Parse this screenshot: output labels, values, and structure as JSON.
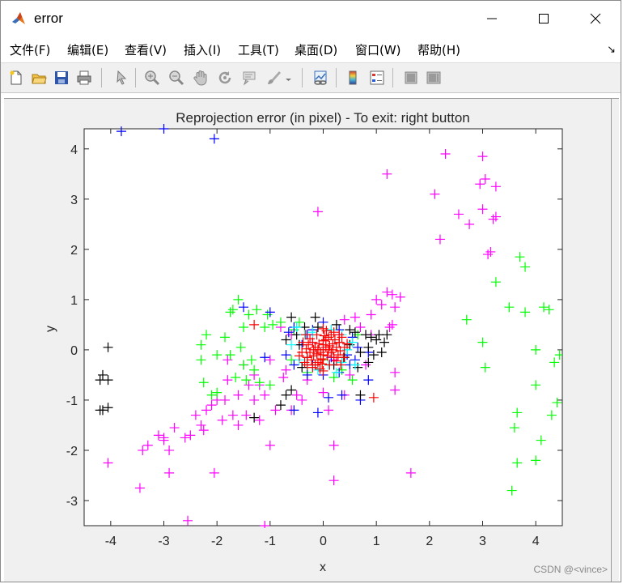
{
  "window": {
    "title": "error",
    "buttons": [
      "minimize",
      "maximize",
      "close"
    ]
  },
  "menubar": {
    "items": [
      {
        "label": "文件(F)"
      },
      {
        "label": "编辑(E)"
      },
      {
        "label": "查看(V)"
      },
      {
        "label": "插入(I)"
      },
      {
        "label": "工具(T)"
      },
      {
        "label": "桌面(D)"
      },
      {
        "label": "窗口(W)"
      },
      {
        "label": "帮助(H)"
      }
    ],
    "overflow_arrow": "↘"
  },
  "toolbar": {
    "icons": [
      "new-figure-icon",
      "open-file-icon",
      "save-icon",
      "print-icon",
      "pointer-icon",
      "zoom-in-icon",
      "zoom-out-icon",
      "pan-icon",
      "rotate-3d-icon",
      "data-cursor-icon",
      "brush-icon",
      "brush-dropdown-icon",
      "link-plot-icon",
      "colorbar-icon",
      "legend-icon",
      "hide-plot-tools-icon",
      "show-plot-tools-icon"
    ]
  },
  "watermark": "CSDN @<vince>",
  "chart_data": {
    "type": "scatter",
    "title": "Reprojection error (in pixel) - To exit: right button",
    "xlabel": "x",
    "ylabel": "y",
    "xlim": [
      -4.5,
      4.5
    ],
    "ylim": [
      -3.5,
      4.4
    ],
    "xticks": [
      -4,
      -3,
      -2,
      -1,
      0,
      1,
      2,
      3,
      4
    ],
    "yticks": [
      -3,
      -2,
      -1,
      0,
      1,
      2,
      3,
      4
    ],
    "marker": "+",
    "grid": false,
    "series": [
      {
        "color": "#ff00ff",
        "points": [
          [
            2.3,
            3.9
          ],
          [
            3.0,
            3.85
          ],
          [
            1.2,
            3.5
          ],
          [
            3.05,
            3.4
          ],
          [
            2.95,
            3.3
          ],
          [
            3.25,
            3.25
          ],
          [
            2.1,
            3.1
          ],
          [
            2.2,
            2.2
          ],
          [
            2.55,
            2.7
          ],
          [
            2.75,
            2.5
          ],
          [
            3.0,
            2.8
          ],
          [
            3.25,
            2.65
          ],
          [
            3.2,
            2.6
          ],
          [
            3.15,
            1.95
          ],
          [
            3.1,
            1.9
          ],
          [
            -0.1,
            2.75
          ],
          [
            1.2,
            1.15
          ],
          [
            1.3,
            1.1
          ],
          [
            1.45,
            1.05
          ],
          [
            1.0,
            1.0
          ],
          [
            1.1,
            0.9
          ],
          [
            1.35,
            0.85
          ],
          [
            0.9,
            0.7
          ],
          [
            0.6,
            0.65
          ],
          [
            1.3,
            0.5
          ],
          [
            1.25,
            0.45
          ],
          [
            0.4,
            0.6
          ],
          [
            0.7,
            0.45
          ],
          [
            -0.8,
            0.45
          ],
          [
            -0.6,
            0.3
          ],
          [
            -1.0,
            -0.2
          ],
          [
            -1.3,
            -0.5
          ],
          [
            -1.4,
            -0.7
          ],
          [
            -1.8,
            -0.6
          ],
          [
            -1.6,
            -0.9
          ],
          [
            -2.0,
            -1.0
          ],
          [
            -2.2,
            -1.2
          ],
          [
            -1.9,
            -1.4
          ],
          [
            -1.6,
            -1.5
          ],
          [
            -2.3,
            -1.5
          ],
          [
            -2.5,
            -1.7
          ],
          [
            -2.6,
            -1.75
          ],
          [
            -3.0,
            -1.8
          ],
          [
            -2.9,
            -2.0
          ],
          [
            -3.3,
            -1.9
          ],
          [
            -3.4,
            -2.0
          ],
          [
            -2.8,
            -1.55
          ],
          [
            -3.0,
            -1.75
          ],
          [
            -1.0,
            -1.9
          ],
          [
            -1.2,
            -1.4
          ],
          [
            -0.9,
            -1.2
          ],
          [
            -0.5,
            -0.9
          ],
          [
            -0.3,
            -0.6
          ],
          [
            -0.6,
            -1.2
          ],
          [
            0.1,
            -1.2
          ],
          [
            0.2,
            -1.9
          ],
          [
            0.2,
            -2.6
          ],
          [
            1.35,
            -0.45
          ],
          [
            1.35,
            -0.8
          ],
          [
            -4.05,
            -2.25
          ],
          [
            -3.45,
            -2.75
          ],
          [
            -2.9,
            -2.45
          ],
          [
            -2.05,
            -2.45
          ],
          [
            -2.55,
            -3.4
          ],
          [
            -1.1,
            -3.5
          ],
          [
            1.65,
            -2.45
          ],
          [
            -1.5,
            -0.3
          ],
          [
            -1.8,
            -0.2
          ],
          [
            -1.2,
            -0.7
          ],
          [
            -0.7,
            -0.4
          ],
          [
            0.5,
            -0.5
          ],
          [
            0.8,
            -0.3
          ],
          [
            0.3,
            0.3
          ],
          [
            -0.2,
            0.15
          ],
          [
            0.2,
            -0.2
          ],
          [
            -2.1,
            -1.1
          ],
          [
            -1.7,
            -1.3
          ],
          [
            -2.4,
            -1.3
          ],
          [
            -3.1,
            -1.7
          ],
          [
            -1.1,
            -0.9
          ],
          [
            -0.4,
            -1.0
          ],
          [
            0.0,
            -0.85
          ],
          [
            0.4,
            -0.9
          ],
          [
            -1.3,
            -1.0
          ],
          [
            -1.45,
            -1.3
          ],
          [
            -2.25,
            -1.6
          ],
          [
            -1.85,
            -1.0
          ],
          [
            -0.75,
            -0.55
          ],
          [
            0.9,
            0.3
          ]
        ]
      },
      {
        "color": "#00ff00",
        "points": [
          [
            3.7,
            1.85
          ],
          [
            3.8,
            1.65
          ],
          [
            3.25,
            1.35
          ],
          [
            3.5,
            0.85
          ],
          [
            3.8,
            0.75
          ],
          [
            4.15,
            0.85
          ],
          [
            4.25,
            0.8
          ],
          [
            2.7,
            0.6
          ],
          [
            3.0,
            0.15
          ],
          [
            4.0,
            0.0
          ],
          [
            4.45,
            -0.1
          ],
          [
            4.35,
            -0.25
          ],
          [
            3.05,
            -0.35
          ],
          [
            4.0,
            -0.7
          ],
          [
            4.4,
            -1.05
          ],
          [
            3.65,
            -1.25
          ],
          [
            4.3,
            -1.3
          ],
          [
            3.6,
            -1.55
          ],
          [
            4.1,
            -1.8
          ],
          [
            3.65,
            -2.25
          ],
          [
            4.0,
            -2.2
          ],
          [
            3.55,
            -2.8
          ],
          [
            -1.6,
            1.0
          ],
          [
            -1.7,
            0.8
          ],
          [
            -1.25,
            0.8
          ],
          [
            -1.4,
            0.7
          ],
          [
            -1.05,
            0.7
          ],
          [
            -0.95,
            0.5
          ],
          [
            -0.8,
            0.55
          ],
          [
            -1.5,
            0.45
          ],
          [
            -1.1,
            0.45
          ],
          [
            -0.55,
            0.4
          ],
          [
            -2.2,
            0.3
          ],
          [
            -1.85,
            0.25
          ],
          [
            -2.3,
            0.1
          ],
          [
            -2.3,
            -0.2
          ],
          [
            -1.55,
            0.05
          ],
          [
            -1.75,
            -0.1
          ],
          [
            -2.0,
            -0.1
          ],
          [
            -1.5,
            -0.3
          ],
          [
            -1.3,
            -0.4
          ],
          [
            -1.65,
            -0.55
          ],
          [
            -2.0,
            -0.85
          ],
          [
            -2.1,
            -0.9
          ],
          [
            -2.25,
            -0.65
          ],
          [
            -1.45,
            -0.6
          ],
          [
            -1.0,
            -0.7
          ],
          [
            -1.2,
            -0.65
          ],
          [
            -0.6,
            -0.2
          ],
          [
            -0.3,
            -0.45
          ],
          [
            0.2,
            -0.55
          ],
          [
            0.35,
            -0.4
          ],
          [
            0.55,
            -0.6
          ],
          [
            -0.2,
            -0.3
          ],
          [
            0.0,
            -0.2
          ],
          [
            -1.75,
            0.75
          ],
          [
            -1.35,
            -0.2
          ],
          [
            0.65,
            0.3
          ],
          [
            -0.45,
            0.55
          ]
        ]
      },
      {
        "color": "#0000ff",
        "points": [
          [
            -3.8,
            4.35
          ],
          [
            -3.0,
            4.4
          ],
          [
            -2.05,
            4.2
          ],
          [
            -1.5,
            0.85
          ],
          [
            -1.0,
            0.75
          ],
          [
            -0.55,
            0.45
          ],
          [
            -0.3,
            0.3
          ],
          [
            0.0,
            0.55
          ],
          [
            0.3,
            0.4
          ],
          [
            0.55,
            0.25
          ],
          [
            0.65,
            0.05
          ],
          [
            0.85,
            -0.05
          ],
          [
            0.5,
            -0.3
          ],
          [
            0.3,
            -0.45
          ],
          [
            0.0,
            -0.5
          ],
          [
            -0.3,
            -0.5
          ],
          [
            -0.55,
            -0.3
          ],
          [
            -0.7,
            -0.1
          ],
          [
            -0.4,
            0.1
          ],
          [
            0.15,
            -0.15
          ],
          [
            0.45,
            -0.1
          ],
          [
            -0.2,
            -0.3
          ],
          [
            0.85,
            -0.6
          ],
          [
            0.35,
            -0.9
          ],
          [
            0.1,
            -0.95
          ],
          [
            -0.1,
            -1.25
          ],
          [
            -0.55,
            -1.2
          ],
          [
            0.7,
            -1.0
          ],
          [
            -0.65,
            0.35
          ],
          [
            -1.1,
            -0.15
          ],
          [
            0.6,
            -0.2
          ],
          [
            -0.2,
            0.4
          ]
        ]
      },
      {
        "color": "#000000",
        "points": [
          [
            -4.05,
            0.05
          ],
          [
            -4.15,
            -0.5
          ],
          [
            -4.2,
            -0.6
          ],
          [
            -4.05,
            -0.6
          ],
          [
            -4.15,
            -1.2
          ],
          [
            -4.05,
            -1.15
          ],
          [
            -4.2,
            -1.2
          ],
          [
            -0.15,
            0.65
          ],
          [
            -0.6,
            0.65
          ],
          [
            -0.1,
            0.45
          ],
          [
            0.25,
            0.5
          ],
          [
            0.5,
            0.4
          ],
          [
            0.6,
            0.35
          ],
          [
            0.8,
            0.3
          ],
          [
            0.9,
            0.25
          ],
          [
            1.0,
            0.2
          ],
          [
            1.05,
            0.3
          ],
          [
            1.15,
            0.15
          ],
          [
            1.2,
            0.3
          ],
          [
            0.85,
            0.05
          ],
          [
            0.7,
            -0.05
          ],
          [
            1.1,
            -0.05
          ],
          [
            0.95,
            -0.1
          ],
          [
            0.5,
            0.1
          ],
          [
            0.3,
            0.15
          ],
          [
            -0.35,
            0.45
          ],
          [
            -0.5,
            0.3
          ],
          [
            -0.7,
            0.2
          ],
          [
            -0.4,
            -0.35
          ],
          [
            -0.3,
            -0.15
          ],
          [
            0.2,
            -0.3
          ],
          [
            0.65,
            -0.35
          ],
          [
            0.85,
            -0.25
          ],
          [
            -0.6,
            -0.8
          ],
          [
            -0.8,
            -1.1
          ],
          [
            -1.3,
            -1.35
          ],
          [
            -0.7,
            -0.9
          ],
          [
            0.7,
            -0.9
          ],
          [
            -0.45,
            0.1
          ],
          [
            0.4,
            -0.15
          ]
        ]
      },
      {
        "color": "#00ffff",
        "points": [
          [
            -0.5,
            0.45
          ],
          [
            -0.35,
            0.3
          ],
          [
            -0.2,
            0.35
          ],
          [
            0.15,
            0.4
          ],
          [
            0.35,
            0.3
          ],
          [
            0.55,
            0.15
          ],
          [
            -0.6,
            0.1
          ],
          [
            -0.45,
            -0.2
          ],
          [
            -0.2,
            -0.35
          ],
          [
            0.1,
            -0.3
          ],
          [
            0.35,
            -0.25
          ],
          [
            0.6,
            -0.3
          ],
          [
            0.25,
            -0.45
          ],
          [
            -0.1,
            -0.4
          ],
          [
            0.45,
            0.0
          ]
        ]
      },
      {
        "color": "#ff0000",
        "points": [
          [
            -1.3,
            0.5
          ],
          [
            0.95,
            -0.95
          ],
          [
            0.0,
            0.0
          ],
          [
            0.05,
            0.05
          ],
          [
            -0.05,
            -0.05
          ],
          [
            0.1,
            0.0
          ],
          [
            -0.1,
            0.0
          ],
          [
            0.0,
            0.1
          ],
          [
            0.0,
            -0.1
          ],
          [
            0.12,
            0.08
          ],
          [
            -0.12,
            -0.08
          ],
          [
            0.08,
            -0.12
          ],
          [
            -0.08,
            0.12
          ],
          [
            0.15,
            -0.05
          ],
          [
            -0.15,
            0.05
          ],
          [
            0.18,
            0.12
          ],
          [
            -0.18,
            -0.12
          ],
          [
            0.2,
            -0.15
          ],
          [
            -0.2,
            0.15
          ],
          [
            0.05,
            0.2
          ],
          [
            -0.05,
            -0.2
          ],
          [
            0.25,
            0.05
          ],
          [
            -0.25,
            -0.05
          ],
          [
            0.22,
            0.2
          ],
          [
            -0.22,
            -0.2
          ],
          [
            0.1,
            0.25
          ],
          [
            -0.1,
            -0.25
          ],
          [
            0.28,
            -0.1
          ],
          [
            -0.28,
            0.1
          ],
          [
            0.3,
            0.15
          ],
          [
            -0.3,
            -0.15
          ],
          [
            0.15,
            0.3
          ],
          [
            -0.15,
            -0.3
          ],
          [
            0.02,
            0.28
          ],
          [
            -0.02,
            -0.28
          ],
          [
            0.32,
            -0.02
          ],
          [
            -0.32,
            0.02
          ],
          [
            0.25,
            -0.22
          ],
          [
            -0.25,
            0.22
          ],
          [
            0.35,
            0.25
          ],
          [
            -0.35,
            -0.25
          ],
          [
            0.12,
            -0.3
          ],
          [
            -0.12,
            0.3
          ],
          [
            0.38,
            -0.15
          ],
          [
            -0.38,
            0.15
          ],
          [
            0.06,
            0.38
          ],
          [
            -0.06,
            -0.38
          ],
          [
            0.3,
            0.3
          ],
          [
            -0.3,
            -0.3
          ],
          [
            0.4,
            0.05
          ],
          [
            -0.4,
            -0.05
          ],
          [
            0.2,
            0.35
          ],
          [
            -0.2,
            -0.35
          ],
          [
            0.33,
            -0.3
          ],
          [
            -0.33,
            0.3
          ],
          [
            0.45,
            0.12
          ],
          [
            -0.45,
            -0.12
          ],
          [
            0.0,
            0.42
          ],
          [
            0.0,
            -0.42
          ],
          [
            0.18,
            0.0
          ],
          [
            -0.18,
            0.0
          ],
          [
            0.0,
            0.18
          ],
          [
            0.0,
            -0.18
          ]
        ]
      }
    ]
  }
}
